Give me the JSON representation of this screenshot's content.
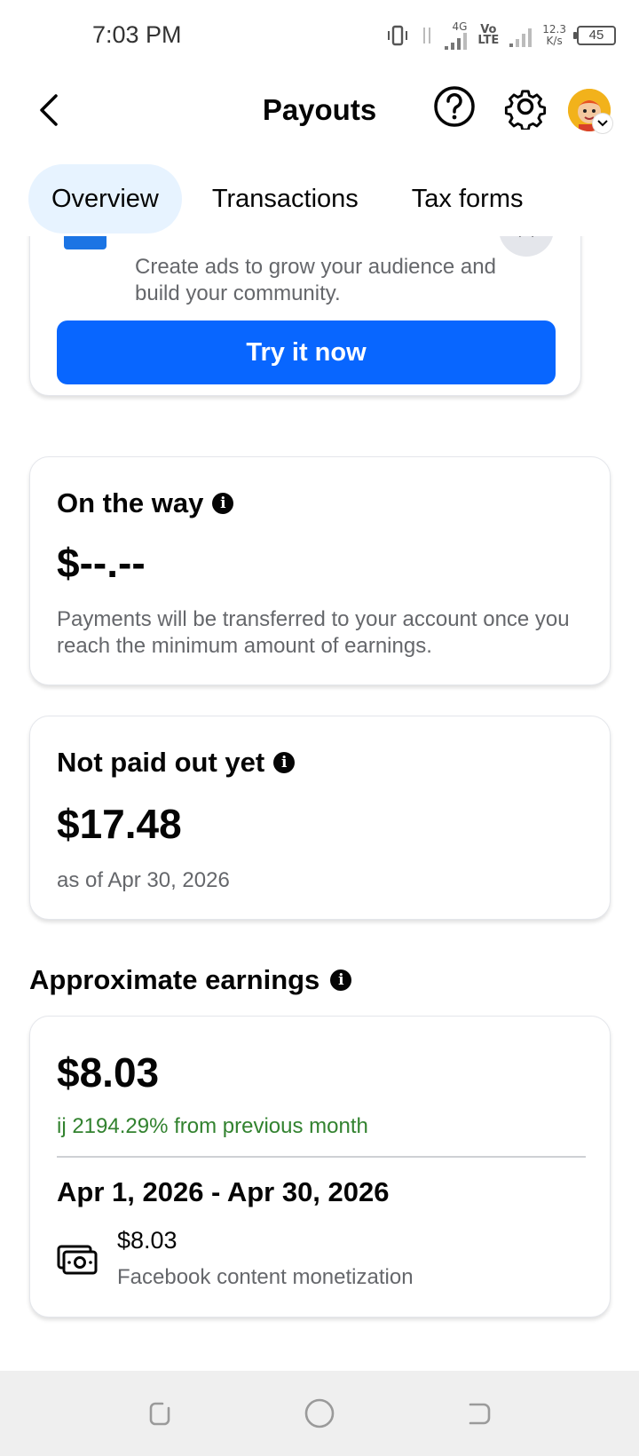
{
  "status_bar": {
    "time": "7:03 PM",
    "net_4g": "4G",
    "volte_top": "Vo",
    "volte_bottom": "LTE",
    "speed_value": "12.3",
    "speed_unit": "K/s",
    "battery": "45"
  },
  "header": {
    "title": "Payouts",
    "back_icon": "chevron-left-icon",
    "help_icon": "question-circle-icon",
    "settings_icon": "gear-icon"
  },
  "tabs": [
    {
      "label": "Overview",
      "active": true
    },
    {
      "label": "Transactions",
      "active": false
    },
    {
      "label": "Tax forms",
      "active": false
    }
  ],
  "promo": {
    "text": "Create ads to grow your audience and build your community.",
    "button_label": "Try it now"
  },
  "on_the_way": {
    "title": "On the way",
    "amount": "$--.--",
    "description": "Payments will be transferred to your account once you reach the minimum amount of earnings."
  },
  "not_paid": {
    "title": "Not paid out yet",
    "amount": "$17.48",
    "as_of": "as of Apr 30, 2026"
  },
  "approx_earnings": {
    "section_title": "Approximate earnings",
    "amount": "$8.03",
    "growth": "ij 2194.29% from previous month",
    "date_range": "Apr 1, 2026 - Apr 30, 2026",
    "line_amount": "$8.03",
    "line_label": "Facebook content monetization"
  },
  "info_glyph": "i",
  "colors": {
    "accent": "#0866ff",
    "active_tab_bg": "#e7f3ff",
    "growth_green": "#32822f",
    "secondary_text": "#65676b"
  }
}
